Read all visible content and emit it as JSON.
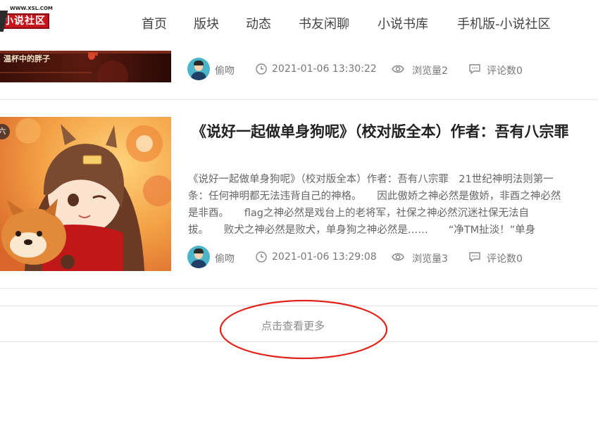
{
  "logo": {
    "url_text": "WWW.XSL.COM",
    "mark_text": "小说社区"
  },
  "nav": [
    "首页",
    "版块",
    "动态",
    "书友闲聊",
    "小说书库",
    "手机版-小说社区"
  ],
  "posts": [
    {
      "cover_caption": "温杯中的胖子",
      "author": "偷吻",
      "date": "2021-01-06 13:30:22",
      "views": "浏览量2",
      "comments": "评论数0"
    },
    {
      "title": "《说好一起做单身狗呢》（校对版全本）作者：吾有八宗罪",
      "excerpt_lines": [
        "《说好一起做单身狗呢》（校对版全本）作者：吾有八宗罪　21世纪神明法则第一",
        "条：任何神明都无法违背自己的神格。　　因此傲娇之神必然是傲娇，非酉之神必然",
        "是非酉。　　flag之神必然是戏台上的老将军，社保之神必然沉迷社保无法自",
        "拔。　　败犬之神必然是败犬，单身狗之神必然是……　　“净TM扯淡！”单身"
      ],
      "cover_badge": "六",
      "author": "偷吻",
      "date": "2021-01-06 13:29:08",
      "views": "浏览量3",
      "comments": "评论数0"
    }
  ],
  "load_more": "点击查看更多",
  "colors": {
    "annotation": "#e2231a",
    "logo_red": "#c4161c",
    "avatar_bg": "#4ab4c8"
  }
}
